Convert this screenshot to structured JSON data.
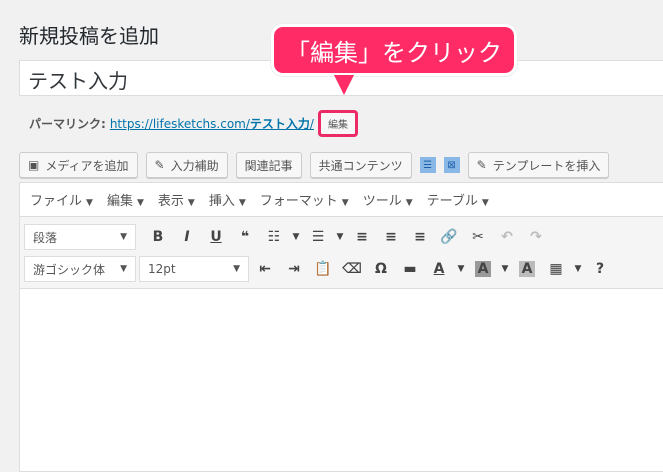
{
  "page_title": "新規投稿を追加",
  "title_value": "テスト入力",
  "permalink": {
    "label": "パーマリンク:",
    "url_base": "https://lifesketchs.com/",
    "slug": "テスト入力",
    "url_end": "/",
    "edit": "編集"
  },
  "callout": "「編集」をクリック",
  "callout_color": "#ff2b66",
  "buttons": [
    "メディアを追加",
    "入力補助",
    "関連記事",
    "共通コンテンツ",
    "テンプレートを挿入"
  ],
  "menu": [
    "ファイル",
    "編集",
    "表示",
    "挿入",
    "フォーマット",
    "ツール",
    "テーブル"
  ],
  "format_select": "段落",
  "font_select": "游ゴシック体",
  "size_select": "12pt"
}
